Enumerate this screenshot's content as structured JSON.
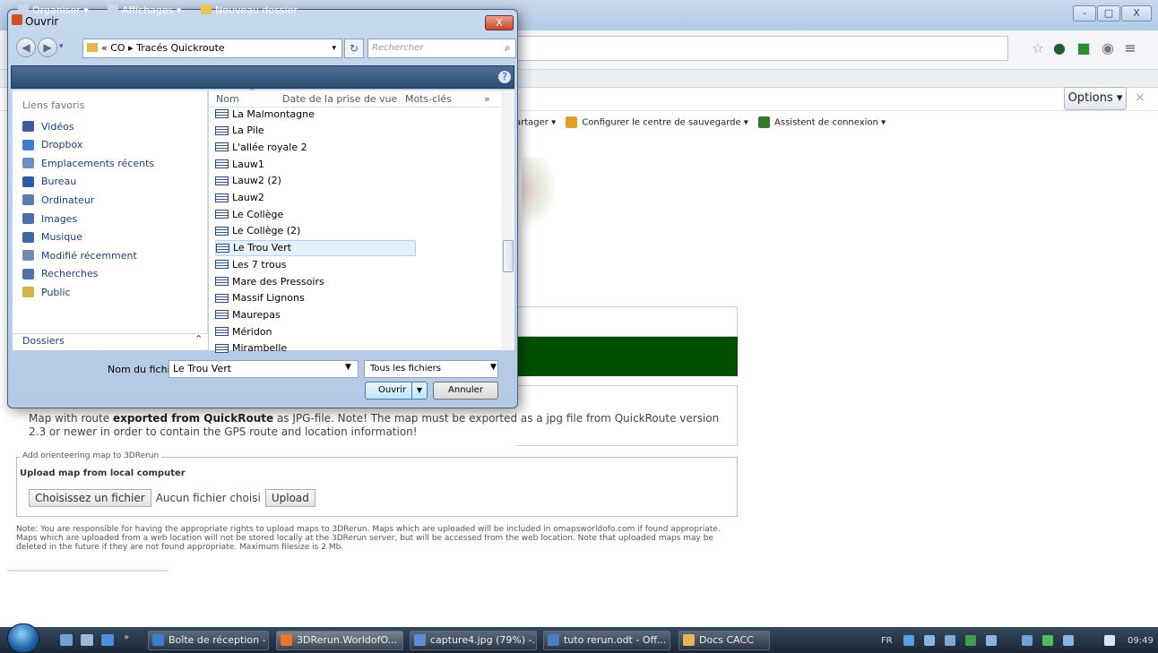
{
  "browser": {
    "window_controls": [
      "-",
      "□",
      "X"
    ],
    "options_label": "Options",
    "options_close": "×",
    "addon_items": [
      "artager",
      "Configurer le centre de sauvegarde",
      "Assistent de connexion"
    ]
  },
  "page": {
    "description_pre": "Map with route ",
    "description_bold": "exported from QuickRoute",
    "description_post": " as JPG-file. Note! The map must be exported as a jpg file from QuickRoute version 2.3 or newer in order to contain the GPS route and location information!",
    "upload_legend": "Add orienteering map to 3DRerun",
    "upload_title": "Upload map from local computer",
    "choose_file_label": "Choisissez un fichier",
    "no_file_text": "Aucun fichier choisi",
    "upload_button": "Upload",
    "note": "Note: You are responsible for having the appropriate rights to upload maps to 3DRerun. Maps which are uploaded will be included in omapsworldofo.com if found appropriate. Maps which are uploaded from a web location will not be stored locally at the 3DRerun server, but will be accessed from the web location. Note that uploaded maps may be deleted in the future if they are not found appropriate. Maximum filesize is 2 Mb."
  },
  "dialog": {
    "title": "Ouvrir",
    "close_label": "X",
    "breadcrumb": {
      "prefix": "«",
      "items": [
        "CO",
        "Tracés Quickroute"
      ],
      "separator": "▸"
    },
    "search_placeholder": "Rechercher",
    "toolbar": {
      "organize": "Organiser",
      "views": "Affichages",
      "new_folder": "Nouveau dossier",
      "help": "?"
    },
    "sidebar": {
      "header": "Liens favoris",
      "items": [
        {
          "label": "Vidéos",
          "icon": "video-icon",
          "color": "#3d5c9e"
        },
        {
          "label": "Dropbox",
          "icon": "dropbox-icon",
          "color": "#3f7fd1"
        },
        {
          "label": "Emplacements récents",
          "icon": "recent-icon",
          "color": "#6b8fbf"
        },
        {
          "label": "Bureau",
          "icon": "desktop-icon",
          "color": "#2e5aa8"
        },
        {
          "label": "Ordinateur",
          "icon": "computer-icon",
          "color": "#5a7ab0"
        },
        {
          "label": "Images",
          "icon": "images-icon",
          "color": "#4b6fa6"
        },
        {
          "label": "Musique",
          "icon": "music-icon",
          "color": "#3c66a8"
        },
        {
          "label": "Modifié récemment",
          "icon": "recent-modified-icon",
          "color": "#6f8cb6"
        },
        {
          "label": "Recherches",
          "icon": "search-folder-icon",
          "color": "#4f72a8"
        },
        {
          "label": "Public",
          "icon": "public-folder-icon",
          "color": "#d9b04a"
        }
      ],
      "folders_label": "Dossiers"
    },
    "columns": [
      "Nom",
      "Date de la prise de vue",
      "Mots-clés"
    ],
    "files": [
      {
        "name": "La Malmontagne",
        "selected": false
      },
      {
        "name": "La Pile",
        "selected": false
      },
      {
        "name": "L'allée royale 2",
        "selected": false
      },
      {
        "name": "Lauw1",
        "selected": false
      },
      {
        "name": "Lauw2 (2)",
        "selected": false
      },
      {
        "name": "Lauw2",
        "selected": false
      },
      {
        "name": "Le Collège",
        "selected": false
      },
      {
        "name": "Le Collège (2)",
        "selected": false
      },
      {
        "name": "Le Trou Vert",
        "selected": true
      },
      {
        "name": "Les 7 trous",
        "selected": false
      },
      {
        "name": "Mare des Pressoirs",
        "selected": false
      },
      {
        "name": "Massif Lignons",
        "selected": false
      },
      {
        "name": "Maurepas",
        "selected": false
      },
      {
        "name": "Méridon",
        "selected": false
      },
      {
        "name": "Mirambelle",
        "selected": false
      }
    ],
    "filename_label": "Nom du fichier :",
    "filename_value": "Le Trou Vert",
    "filetype_value": "Tous les fichiers",
    "open_label": "Ouvrir",
    "cancel_label": "Annuler"
  },
  "taskbar": {
    "tasks": [
      {
        "label": "Boîte de réception - ...",
        "color": "#3f7fd1",
        "active": false
      },
      {
        "label": "3DRerun.WorldofO...",
        "color": "#e8752a",
        "active": true
      },
      {
        "label": "capture4.jpg (79%) -...",
        "color": "#5a8fcf",
        "active": false
      },
      {
        "label": "tuto rerun.odt - Off...",
        "color": "#4a7fc0",
        "active": false
      },
      {
        "label": "Docs CACC",
        "color": "#e1b84b",
        "active": false
      }
    ],
    "lang": "FR",
    "clock": "09:49"
  }
}
